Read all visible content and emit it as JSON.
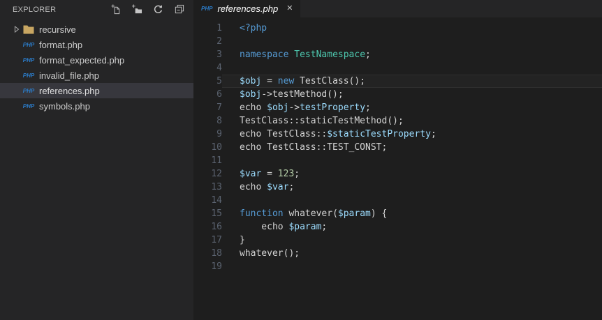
{
  "colors": {
    "editor_bg": "#1E1E1E",
    "sidebar_bg": "#252526",
    "tabstrip_bg": "#252526",
    "selected_row_bg": "#37373D",
    "line_number": "#5B6370",
    "php_badge": "#2B7CC9",
    "folder": "#C8A662",
    "icon": "#C5C5C5",
    "tokens": {
      "kw": "#569CD6",
      "cls": "#4EC9B0",
      "var": "#9CDCFE",
      "num": "#B5CEA8",
      "def": "#D4D4D4"
    }
  },
  "explorer": {
    "title": "EXPLORER",
    "php_badge_text": "PHP",
    "actions": [
      {
        "name": "new-file",
        "icon": "new-file-icon"
      },
      {
        "name": "new-folder",
        "icon": "new-folder-icon"
      },
      {
        "name": "refresh",
        "icon": "refresh-icon"
      },
      {
        "name": "collapse-all",
        "icon": "collapse-all-icon"
      }
    ],
    "items": [
      {
        "label": "recursive",
        "kind": "folder",
        "selected": false
      },
      {
        "label": "format.php",
        "kind": "php-file",
        "selected": false
      },
      {
        "label": "format_expected.php",
        "kind": "php-file",
        "selected": false
      },
      {
        "label": "invalid_file.php",
        "kind": "php-file",
        "selected": false
      },
      {
        "label": "references.php",
        "kind": "php-file",
        "selected": true
      },
      {
        "label": "symbols.php",
        "kind": "php-file",
        "selected": false
      }
    ]
  },
  "tab": {
    "title": "references.php",
    "icon_text": "PHP",
    "close_glyph": "✕"
  },
  "editor": {
    "language": "php",
    "current_line": 5,
    "lines": [
      {
        "num": 1,
        "tokens": [
          {
            "t": "<?php",
            "c": "kw"
          }
        ]
      },
      {
        "num": 2,
        "tokens": []
      },
      {
        "num": 3,
        "tokens": [
          {
            "t": "namespace",
            "c": "kw"
          },
          {
            "t": " ",
            "c": "def"
          },
          {
            "t": "TestNamespace",
            "c": "cls"
          },
          {
            "t": ";",
            "c": "def"
          }
        ]
      },
      {
        "num": 4,
        "tokens": []
      },
      {
        "num": 5,
        "current": true,
        "tokens": [
          {
            "t": "$obj",
            "c": "var"
          },
          {
            "t": " = ",
            "c": "def"
          },
          {
            "t": "new",
            "c": "kw"
          },
          {
            "t": " TestClass();",
            "c": "def"
          }
        ]
      },
      {
        "num": 6,
        "tokens": [
          {
            "t": "$obj",
            "c": "var"
          },
          {
            "t": "->testMethod();",
            "c": "def"
          }
        ]
      },
      {
        "num": 7,
        "tokens": [
          {
            "t": "echo ",
            "c": "def"
          },
          {
            "t": "$obj",
            "c": "var"
          },
          {
            "t": "->",
            "c": "def"
          },
          {
            "t": "testProperty",
            "c": "var"
          },
          {
            "t": ";",
            "c": "def"
          }
        ]
      },
      {
        "num": 8,
        "tokens": [
          {
            "t": "TestClass::staticTestMethod();",
            "c": "def"
          }
        ]
      },
      {
        "num": 9,
        "tokens": [
          {
            "t": "echo TestClass::",
            "c": "def"
          },
          {
            "t": "$staticTestProperty",
            "c": "var"
          },
          {
            "t": ";",
            "c": "def"
          }
        ]
      },
      {
        "num": 10,
        "tokens": [
          {
            "t": "echo TestClass::TEST_CONST;",
            "c": "def"
          }
        ]
      },
      {
        "num": 11,
        "tokens": []
      },
      {
        "num": 12,
        "tokens": [
          {
            "t": "$var",
            "c": "var"
          },
          {
            "t": " = ",
            "c": "def"
          },
          {
            "t": "123",
            "c": "num"
          },
          {
            "t": ";",
            "c": "def"
          }
        ]
      },
      {
        "num": 13,
        "tokens": [
          {
            "t": "echo ",
            "c": "def"
          },
          {
            "t": "$var",
            "c": "var"
          },
          {
            "t": ";",
            "c": "def"
          }
        ]
      },
      {
        "num": 14,
        "tokens": []
      },
      {
        "num": 15,
        "tokens": [
          {
            "t": "function",
            "c": "kw"
          },
          {
            "t": " whatever(",
            "c": "def"
          },
          {
            "t": "$param",
            "c": "var"
          },
          {
            "t": ") {",
            "c": "def"
          }
        ]
      },
      {
        "num": 16,
        "tokens": [
          {
            "t": "    echo ",
            "c": "def"
          },
          {
            "t": "$param",
            "c": "var"
          },
          {
            "t": ";",
            "c": "def"
          }
        ]
      },
      {
        "num": 17,
        "tokens": [
          {
            "t": "}",
            "c": "def"
          }
        ]
      },
      {
        "num": 18,
        "tokens": [
          {
            "t": "whatever();",
            "c": "def"
          }
        ]
      },
      {
        "num": 19,
        "tokens": []
      }
    ]
  }
}
